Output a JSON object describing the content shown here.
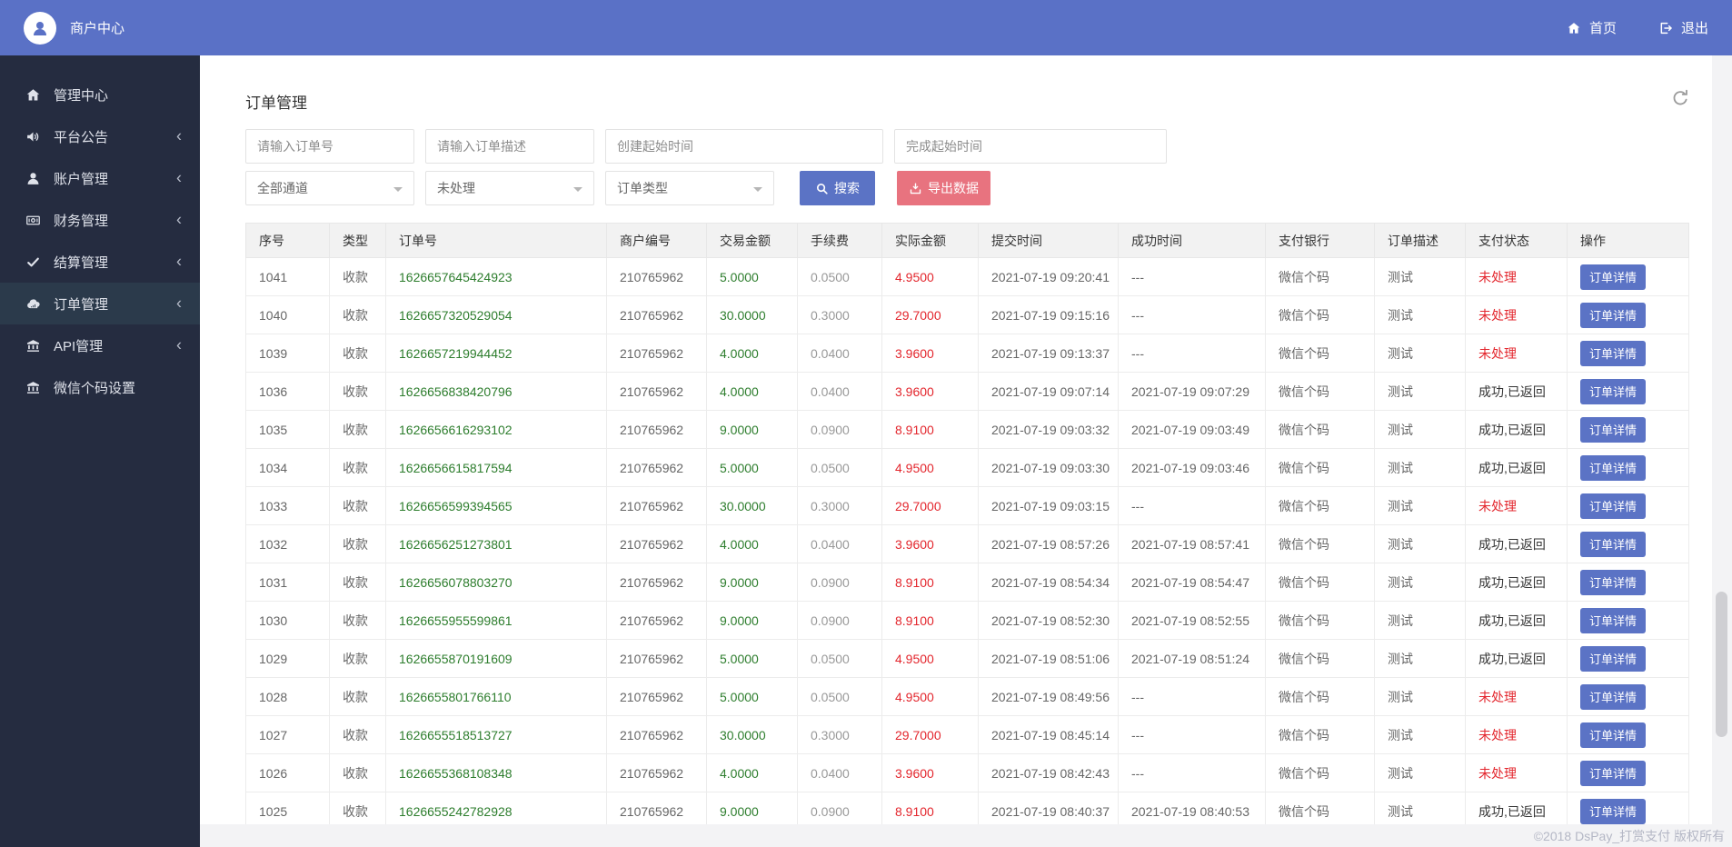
{
  "colors": {
    "header_bg": "#5a71c6",
    "sidebar_bg": "#252c40",
    "sidebar_active_bg": "#2b3a4b",
    "accent_blue": "#5b73c5",
    "export_red": "#e8737f",
    "amount_green": "#2d7d2d",
    "status_red": "#e3262d"
  },
  "header": {
    "brand": "商户中心",
    "nav": [
      {
        "key": "home",
        "icon": "home",
        "label": "首页"
      },
      {
        "key": "logout",
        "icon": "logout",
        "label": "退出"
      }
    ]
  },
  "sidebar": {
    "items": [
      {
        "key": "admin-center",
        "icon": "home",
        "label": "管理中心",
        "chevron": false,
        "active": false
      },
      {
        "key": "platform-announcement",
        "icon": "speaker",
        "label": "平台公告",
        "chevron": true,
        "active": false
      },
      {
        "key": "account-management",
        "icon": "user",
        "label": "账户管理",
        "chevron": true,
        "active": false
      },
      {
        "key": "finance-management",
        "icon": "money",
        "label": "财务管理",
        "chevron": true,
        "active": false
      },
      {
        "key": "settlement-management",
        "icon": "check",
        "label": "结算管理",
        "chevron": true,
        "active": false
      },
      {
        "key": "order-management",
        "icon": "cloud",
        "label": "订单管理",
        "chevron": true,
        "active": true
      },
      {
        "key": "api-management",
        "icon": "bank",
        "label": "API管理",
        "chevron": true,
        "active": false
      },
      {
        "key": "wechat-code-settings",
        "icon": "bank",
        "label": "微信个码设置",
        "chevron": false,
        "active": false
      }
    ]
  },
  "page": {
    "title": "订单管理"
  },
  "filters": {
    "order_no_placeholder": "请输入订单号",
    "order_desc_placeholder": "请输入订单描述",
    "create_time_placeholder": "创建起始时间",
    "finish_time_placeholder": "完成起始时间",
    "channel_select": "全部通道",
    "status_select": "未处理",
    "type_select": "订单类型",
    "search_label": "搜索",
    "export_label": "导出数据"
  },
  "table": {
    "columns": [
      "序号",
      "类型",
      "订单号",
      "商户编号",
      "交易金额",
      "手续费",
      "实际金额",
      "提交时间",
      "成功时间",
      "支付银行",
      "订单描述",
      "支付状态",
      "操作"
    ],
    "action_label": "订单详情",
    "rows": [
      {
        "index": "1041",
        "type": "收款",
        "order_no": "1626657645424923",
        "merchant_id": "210765962",
        "amount": "5.0000",
        "fee": "0.0500",
        "actual": "4.9500",
        "submit_time": "2021-07-19 09:20:41",
        "success_time": "---",
        "bank": "微信个码",
        "desc": "测试",
        "status": "未处理",
        "status_state": "pending"
      },
      {
        "index": "1040",
        "type": "收款",
        "order_no": "1626657320529054",
        "merchant_id": "210765962",
        "amount": "30.0000",
        "fee": "0.3000",
        "actual": "29.7000",
        "submit_time": "2021-07-19 09:15:16",
        "success_time": "---",
        "bank": "微信个码",
        "desc": "测试",
        "status": "未处理",
        "status_state": "pending"
      },
      {
        "index": "1039",
        "type": "收款",
        "order_no": "1626657219944452",
        "merchant_id": "210765962",
        "amount": "4.0000",
        "fee": "0.0400",
        "actual": "3.9600",
        "submit_time": "2021-07-19 09:13:37",
        "success_time": "---",
        "bank": "微信个码",
        "desc": "测试",
        "status": "未处理",
        "status_state": "pending"
      },
      {
        "index": "1036",
        "type": "收款",
        "order_no": "1626656838420796",
        "merchant_id": "210765962",
        "amount": "4.0000",
        "fee": "0.0400",
        "actual": "3.9600",
        "submit_time": "2021-07-19 09:07:14",
        "success_time": "2021-07-19 09:07:29",
        "bank": "微信个码",
        "desc": "测试",
        "status": "成功,已返回",
        "status_state": "success"
      },
      {
        "index": "1035",
        "type": "收款",
        "order_no": "1626656616293102",
        "merchant_id": "210765962",
        "amount": "9.0000",
        "fee": "0.0900",
        "actual": "8.9100",
        "submit_time": "2021-07-19 09:03:32",
        "success_time": "2021-07-19 09:03:49",
        "bank": "微信个码",
        "desc": "测试",
        "status": "成功,已返回",
        "status_state": "success"
      },
      {
        "index": "1034",
        "type": "收款",
        "order_no": "1626656615817594",
        "merchant_id": "210765962",
        "amount": "5.0000",
        "fee": "0.0500",
        "actual": "4.9500",
        "submit_time": "2021-07-19 09:03:30",
        "success_time": "2021-07-19 09:03:46",
        "bank": "微信个码",
        "desc": "测试",
        "status": "成功,已返回",
        "status_state": "success"
      },
      {
        "index": "1033",
        "type": "收款",
        "order_no": "1626656599394565",
        "merchant_id": "210765962",
        "amount": "30.0000",
        "fee": "0.3000",
        "actual": "29.7000",
        "submit_time": "2021-07-19 09:03:15",
        "success_time": "---",
        "bank": "微信个码",
        "desc": "测试",
        "status": "未处理",
        "status_state": "pending"
      },
      {
        "index": "1032",
        "type": "收款",
        "order_no": "1626656251273801",
        "merchant_id": "210765962",
        "amount": "4.0000",
        "fee": "0.0400",
        "actual": "3.9600",
        "submit_time": "2021-07-19 08:57:26",
        "success_time": "2021-07-19 08:57:41",
        "bank": "微信个码",
        "desc": "测试",
        "status": "成功,已返回",
        "status_state": "success"
      },
      {
        "index": "1031",
        "type": "收款",
        "order_no": "1626656078803270",
        "merchant_id": "210765962",
        "amount": "9.0000",
        "fee": "0.0900",
        "actual": "8.9100",
        "submit_time": "2021-07-19 08:54:34",
        "success_time": "2021-07-19 08:54:47",
        "bank": "微信个码",
        "desc": "测试",
        "status": "成功,已返回",
        "status_state": "success"
      },
      {
        "index": "1030",
        "type": "收款",
        "order_no": "1626655955599861",
        "merchant_id": "210765962",
        "amount": "9.0000",
        "fee": "0.0900",
        "actual": "8.9100",
        "submit_time": "2021-07-19 08:52:30",
        "success_time": "2021-07-19 08:52:55",
        "bank": "微信个码",
        "desc": "测试",
        "status": "成功,已返回",
        "status_state": "success"
      },
      {
        "index": "1029",
        "type": "收款",
        "order_no": "1626655870191609",
        "merchant_id": "210765962",
        "amount": "5.0000",
        "fee": "0.0500",
        "actual": "4.9500",
        "submit_time": "2021-07-19 08:51:06",
        "success_time": "2021-07-19 08:51:24",
        "bank": "微信个码",
        "desc": "测试",
        "status": "成功,已返回",
        "status_state": "success"
      },
      {
        "index": "1028",
        "type": "收款",
        "order_no": "1626655801766110",
        "merchant_id": "210765962",
        "amount": "5.0000",
        "fee": "0.0500",
        "actual": "4.9500",
        "submit_time": "2021-07-19 08:49:56",
        "success_time": "---",
        "bank": "微信个码",
        "desc": "测试",
        "status": "未处理",
        "status_state": "pending"
      },
      {
        "index": "1027",
        "type": "收款",
        "order_no": "1626655518513727",
        "merchant_id": "210765962",
        "amount": "30.0000",
        "fee": "0.3000",
        "actual": "29.7000",
        "submit_time": "2021-07-19 08:45:14",
        "success_time": "---",
        "bank": "微信个码",
        "desc": "测试",
        "status": "未处理",
        "status_state": "pending"
      },
      {
        "index": "1026",
        "type": "收款",
        "order_no": "1626655368108348",
        "merchant_id": "210765962",
        "amount": "4.0000",
        "fee": "0.0400",
        "actual": "3.9600",
        "submit_time": "2021-07-19 08:42:43",
        "success_time": "---",
        "bank": "微信个码",
        "desc": "测试",
        "status": "未处理",
        "status_state": "pending"
      },
      {
        "index": "1025",
        "type": "收款",
        "order_no": "1626655242782928",
        "merchant_id": "210765962",
        "amount": "9.0000",
        "fee": "0.0900",
        "actual": "8.9100",
        "submit_time": "2021-07-19 08:40:37",
        "success_time": "2021-07-19 08:40:53",
        "bank": "微信个码",
        "desc": "测试",
        "status": "成功,已返回",
        "status_state": "success"
      }
    ]
  },
  "footer": {
    "copyright": "©2018 DsPay_打赏支付 版权所有"
  }
}
